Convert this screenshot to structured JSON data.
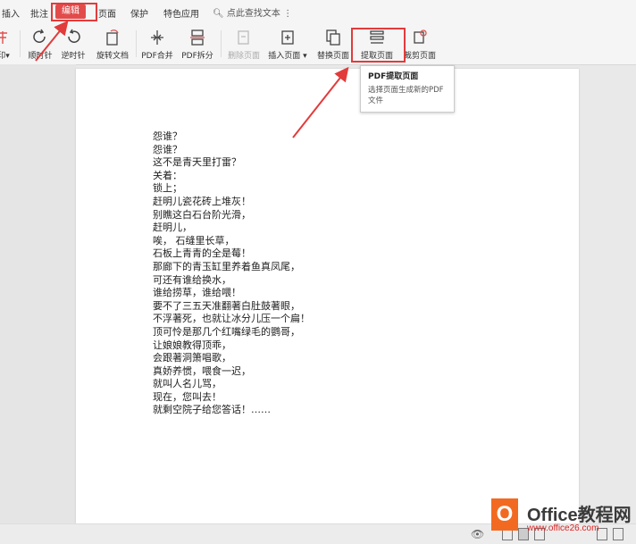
{
  "menu": {
    "items": [
      "插入",
      "批注",
      "页面",
      "保护",
      "特色应用"
    ],
    "active": "编辑",
    "search": "点此查找文本"
  },
  "toolbar": {
    "tools": [
      {
        "label": "顺时针",
        "icon": "rotate-clockwise-icon"
      },
      {
        "label": "逆时针",
        "icon": "rotate-counterclockwise-icon"
      },
      {
        "label": "旋转文档",
        "icon": "rotate-document-icon"
      },
      {
        "label": "PDF合并",
        "icon": "pdf-merge-icon"
      },
      {
        "label": "PDF拆分",
        "icon": "pdf-split-icon"
      },
      {
        "label": "删除页面",
        "icon": "delete-page-icon"
      },
      {
        "label": "插入页面",
        "icon": "insert-page-icon"
      },
      {
        "label": "替换页面",
        "icon": "replace-page-icon"
      },
      {
        "label": "提取页面",
        "icon": "extract-page-icon"
      },
      {
        "label": "裁剪页面",
        "icon": "crop-page-icon"
      }
    ]
  },
  "tooltip": {
    "title": "PDF提取页面",
    "desc": "选择页面生成新的PDF文件"
  },
  "document": {
    "lines": [
      "怨谁？",
      "怨谁？",
      "这不是青天里打雷？",
      "关着：",
      "锁上；",
      "赶明儿瓷花砖上堆灰！",
      "别瞧这白石台阶光滑，",
      "赶明儿，",
      "唉，  石缝里长草，",
      "石板上青青的全是莓！",
      "那廊下的青玉缸里养着鱼真凤尾，",
      "可还有谁给换水，",
      "谁给捞草，谁给喂！",
      "要不了三五天准翻著白肚鼓著眼，",
      "不浮著死，也就让冰分儿压一个扁！",
      "顶可怜是那几个红嘴绿毛的鹦哥，",
      "让娘娘教得顶乖，",
      "会跟著洞箫唱歌，",
      "真娇养惯，喂食一迟，",
      "就叫人名儿骂，",
      "现在，您叫去！",
      "就剩空院子给您答话！……"
    ]
  },
  "logo": {
    "brand": "Office教程网",
    "url": "www.office26.com"
  },
  "colors": {
    "accent": "#e34b4b",
    "highlight": "#e23b3b",
    "logo_orange": "#f26a21"
  }
}
